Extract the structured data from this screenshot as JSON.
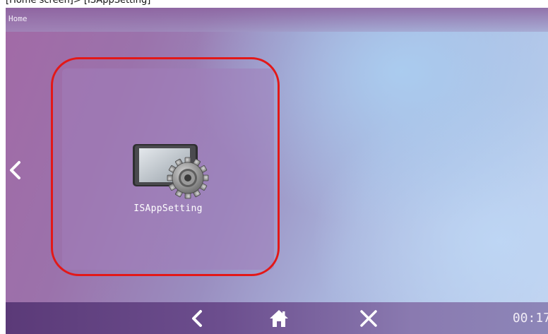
{
  "top_caption": "[Home screen]> [ISAppSetting]",
  "header": {
    "title": "Home"
  },
  "app": {
    "label": "ISAppSetting",
    "icon": "tablet-gear-icon"
  },
  "nav": {
    "left_arrow_icon": "chevron-left-icon",
    "back_icon": "back-icon",
    "home_icon": "home-icon",
    "close_icon": "close-icon"
  },
  "status": {
    "clock": "00:17"
  },
  "colors": {
    "highlight": "#e31818",
    "footer": "#5b3a78"
  }
}
